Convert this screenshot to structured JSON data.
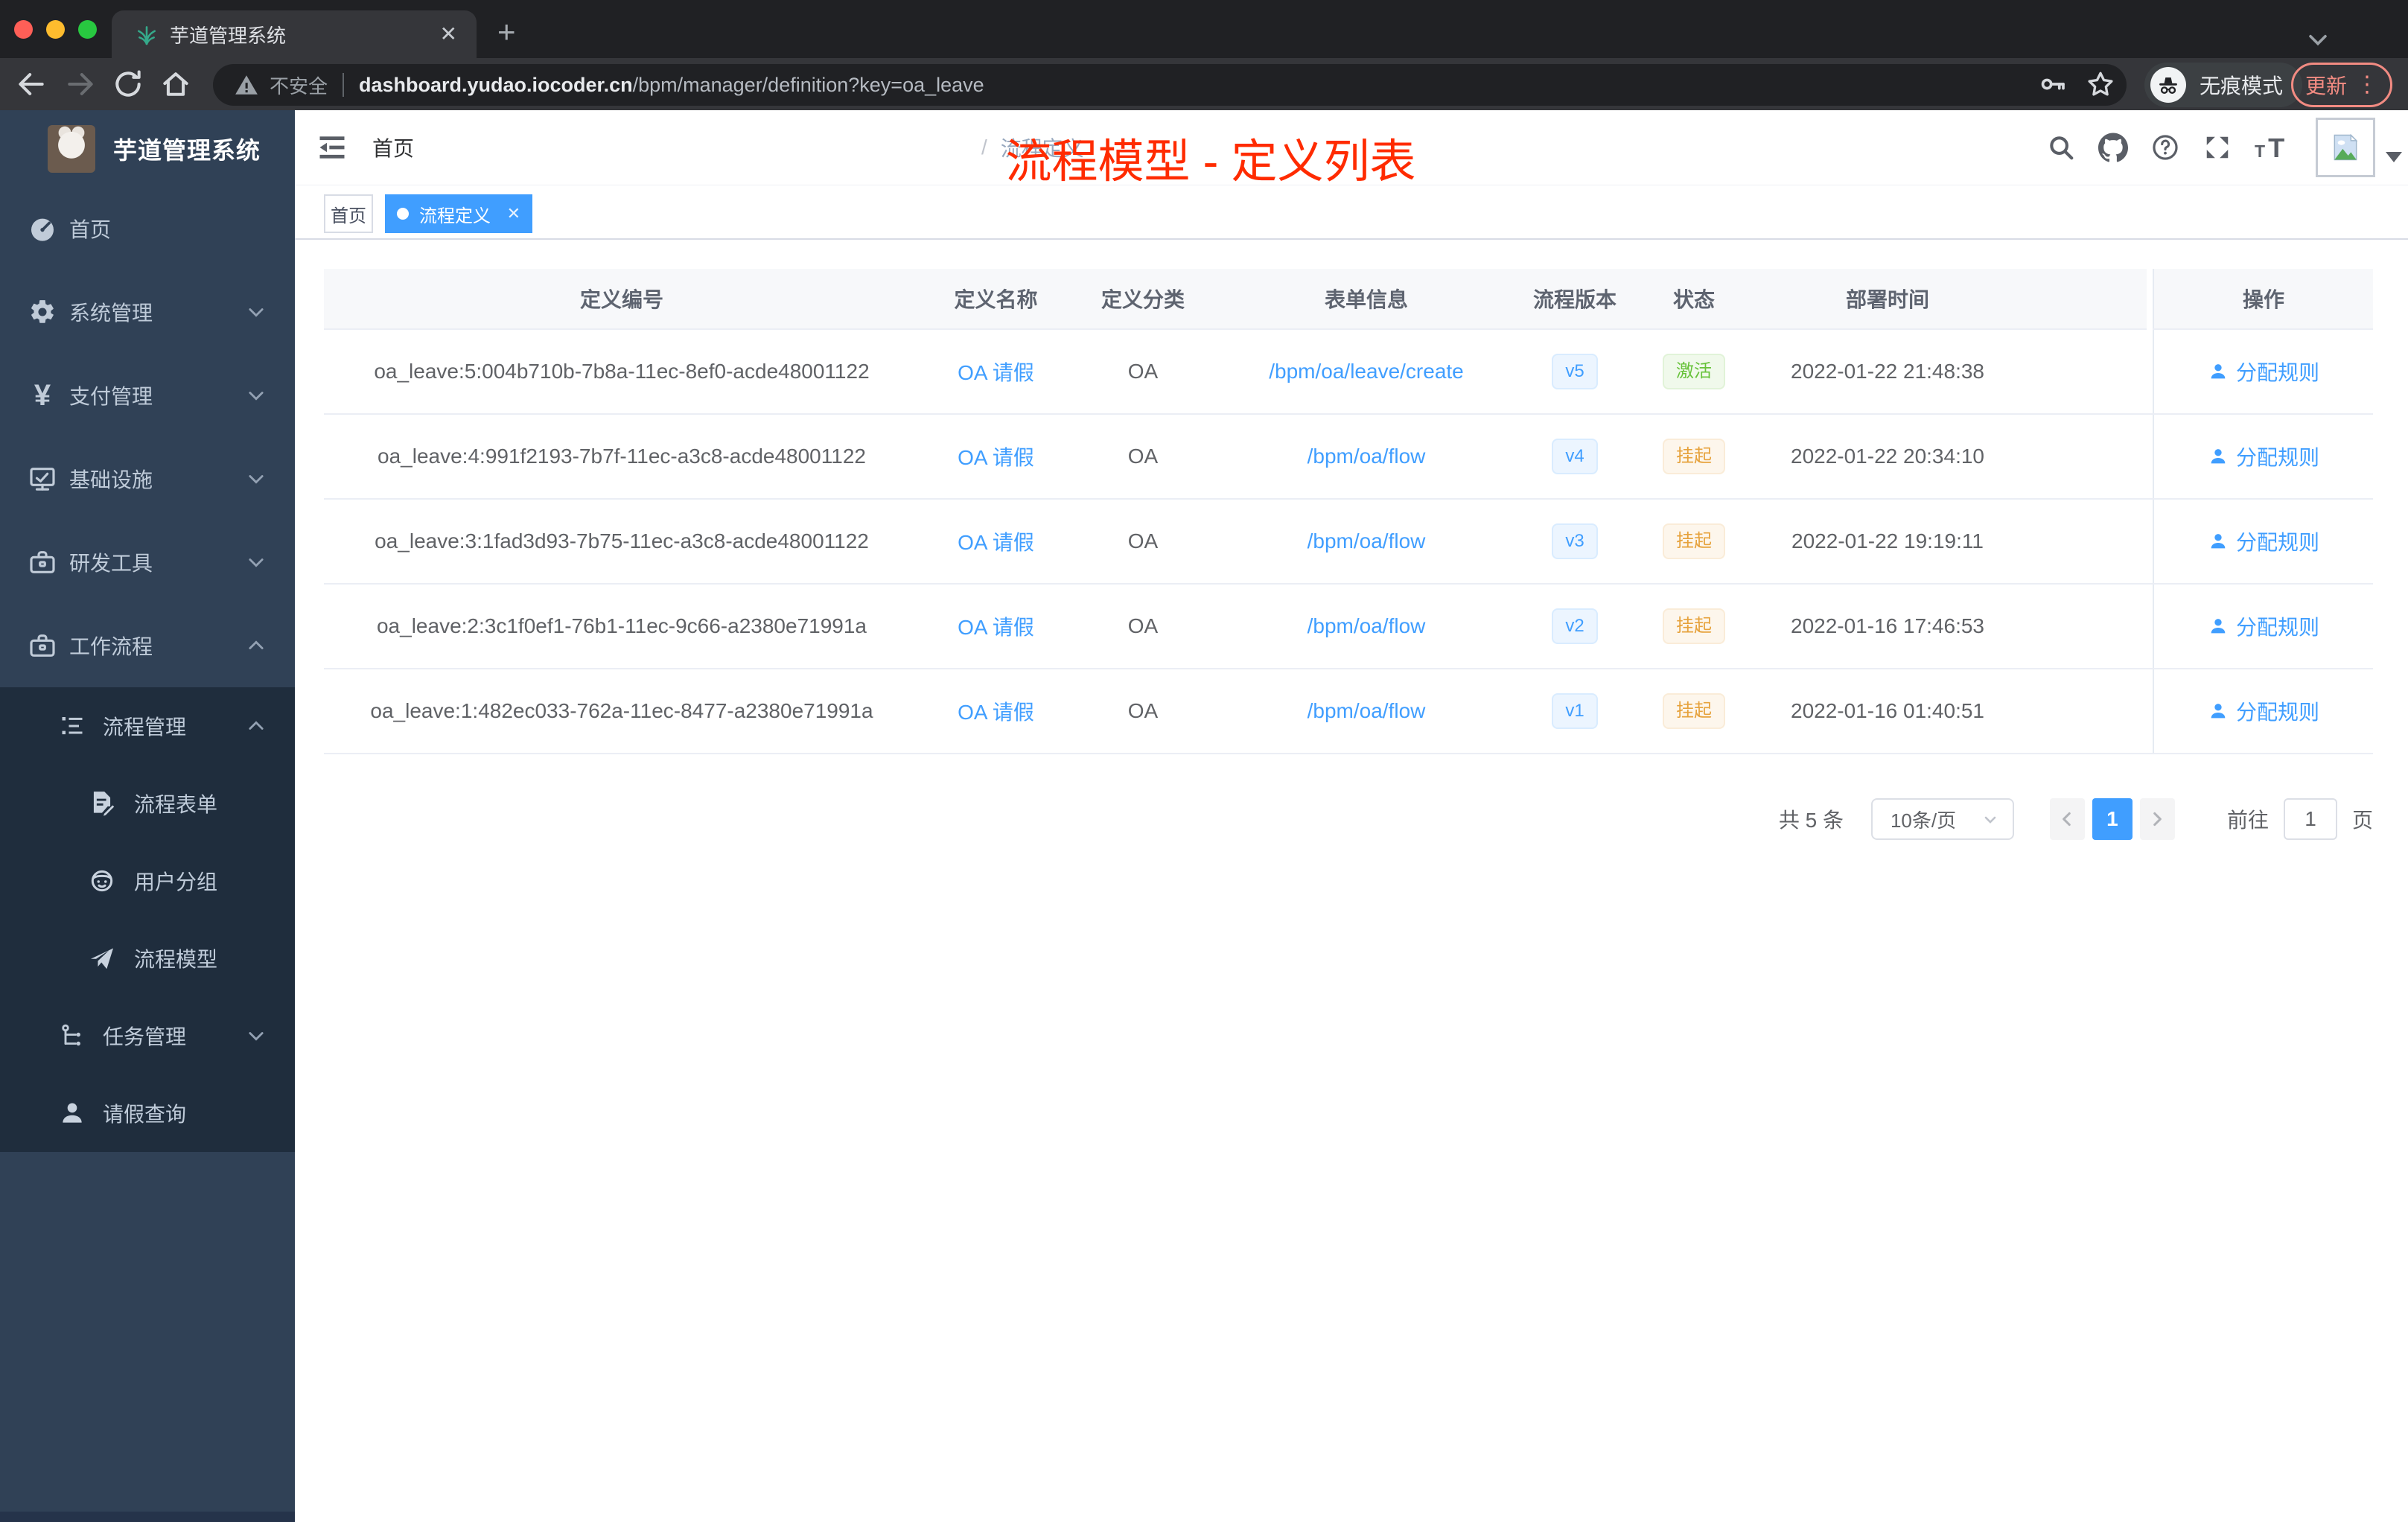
{
  "colors": {
    "accent": "#409eff",
    "annotation_red": "#ff2b00",
    "success": "#67c23a",
    "warning": "#e6a23c",
    "sidebar_bg": "#304156",
    "sidebar_sub_bg": "#1f2d3d",
    "active_tag_bg": "#409eff"
  },
  "browser": {
    "tab_title": "芋道管理系统",
    "security_label": "不安全",
    "url_domain": "dashboard.yudao.iocoder.cn",
    "url_path": "/bpm/manager/definition?key=oa_leave",
    "incognito_label": "无痕模式",
    "update_label": "更新",
    "menu_dots": "⋮"
  },
  "sidebar": {
    "brand": "芋道管理系统",
    "items": [
      {
        "label": "首页",
        "icon": "dashboard-icon",
        "level": 1
      },
      {
        "label": "系统管理",
        "icon": "gear-icon",
        "level": 1,
        "chevron": "down"
      },
      {
        "label": "支付管理",
        "icon": "yen-icon",
        "level": 1,
        "chevron": "down"
      },
      {
        "label": "基础设施",
        "icon": "monitor-icon",
        "level": 1,
        "chevron": "down"
      },
      {
        "label": "研发工具",
        "icon": "toolbox-icon",
        "level": 1,
        "chevron": "down"
      },
      {
        "label": "工作流程",
        "icon": "briefcase-icon",
        "level": 1,
        "chevron": "up"
      },
      {
        "label": "流程管理",
        "icon": "tree-table-icon",
        "level": 2,
        "chevron": "up"
      },
      {
        "label": "流程表单",
        "icon": "form-icon",
        "level": 3
      },
      {
        "label": "用户分组",
        "icon": "robot-icon",
        "level": 3
      },
      {
        "label": "流程模型",
        "icon": "paper-plane-icon",
        "level": 3
      },
      {
        "label": "任务管理",
        "icon": "tree-icon",
        "level": 2,
        "chevron": "down"
      },
      {
        "label": "请假查询",
        "icon": "user-icon",
        "level": 2
      }
    ]
  },
  "header": {
    "breadcrumb": [
      "首页",
      "流程定义"
    ],
    "annotation": "流程模型 - 定义列表"
  },
  "tags": [
    {
      "label": "首页",
      "active": false
    },
    {
      "label": "流程定义",
      "active": true,
      "closable": true
    }
  ],
  "table": {
    "columns": [
      "定义编号",
      "定义名称",
      "定义分类",
      "表单信息",
      "流程版本",
      "状态",
      "部署时间",
      "操作"
    ],
    "rows": [
      {
        "id": "oa_leave:5:004b710b-7b8a-11ec-8ef0-acde48001122",
        "name": "OA 请假",
        "category": "OA",
        "form": "/bpm/oa/leave/create",
        "version": "v5",
        "status": "激活",
        "time": "2022-01-22 21:48:38",
        "action": "分配规则"
      },
      {
        "id": "oa_leave:4:991f2193-7b7f-11ec-a3c8-acde48001122",
        "name": "OA 请假",
        "category": "OA",
        "form": "/bpm/oa/flow",
        "version": "v4",
        "status": "挂起",
        "time": "2022-01-22 20:34:10",
        "action": "分配规则"
      },
      {
        "id": "oa_leave:3:1fad3d93-7b75-11ec-a3c8-acde48001122",
        "name": "OA 请假",
        "category": "OA",
        "form": "/bpm/oa/flow",
        "version": "v3",
        "status": "挂起",
        "time": "2022-01-22 19:19:11",
        "action": "分配规则"
      },
      {
        "id": "oa_leave:2:3c1f0ef1-76b1-11ec-9c66-a2380e71991a",
        "name": "OA 请假",
        "category": "OA",
        "form": "/bpm/oa/flow",
        "version": "v2",
        "status": "挂起",
        "time": "2022-01-16 17:46:53",
        "action": "分配规则"
      },
      {
        "id": "oa_leave:1:482ec033-762a-11ec-8477-a2380e71991a",
        "name": "OA 请假",
        "category": "OA",
        "form": "/bpm/oa/flow",
        "version": "v1",
        "status": "挂起",
        "time": "2022-01-16 01:40:51",
        "action": "分配规则"
      }
    ]
  },
  "pagination": {
    "total": "共 5 条",
    "page_size": "10条/页",
    "current_page": "1",
    "goto_label": "前往",
    "goto_value": "1",
    "page_unit": "页"
  }
}
